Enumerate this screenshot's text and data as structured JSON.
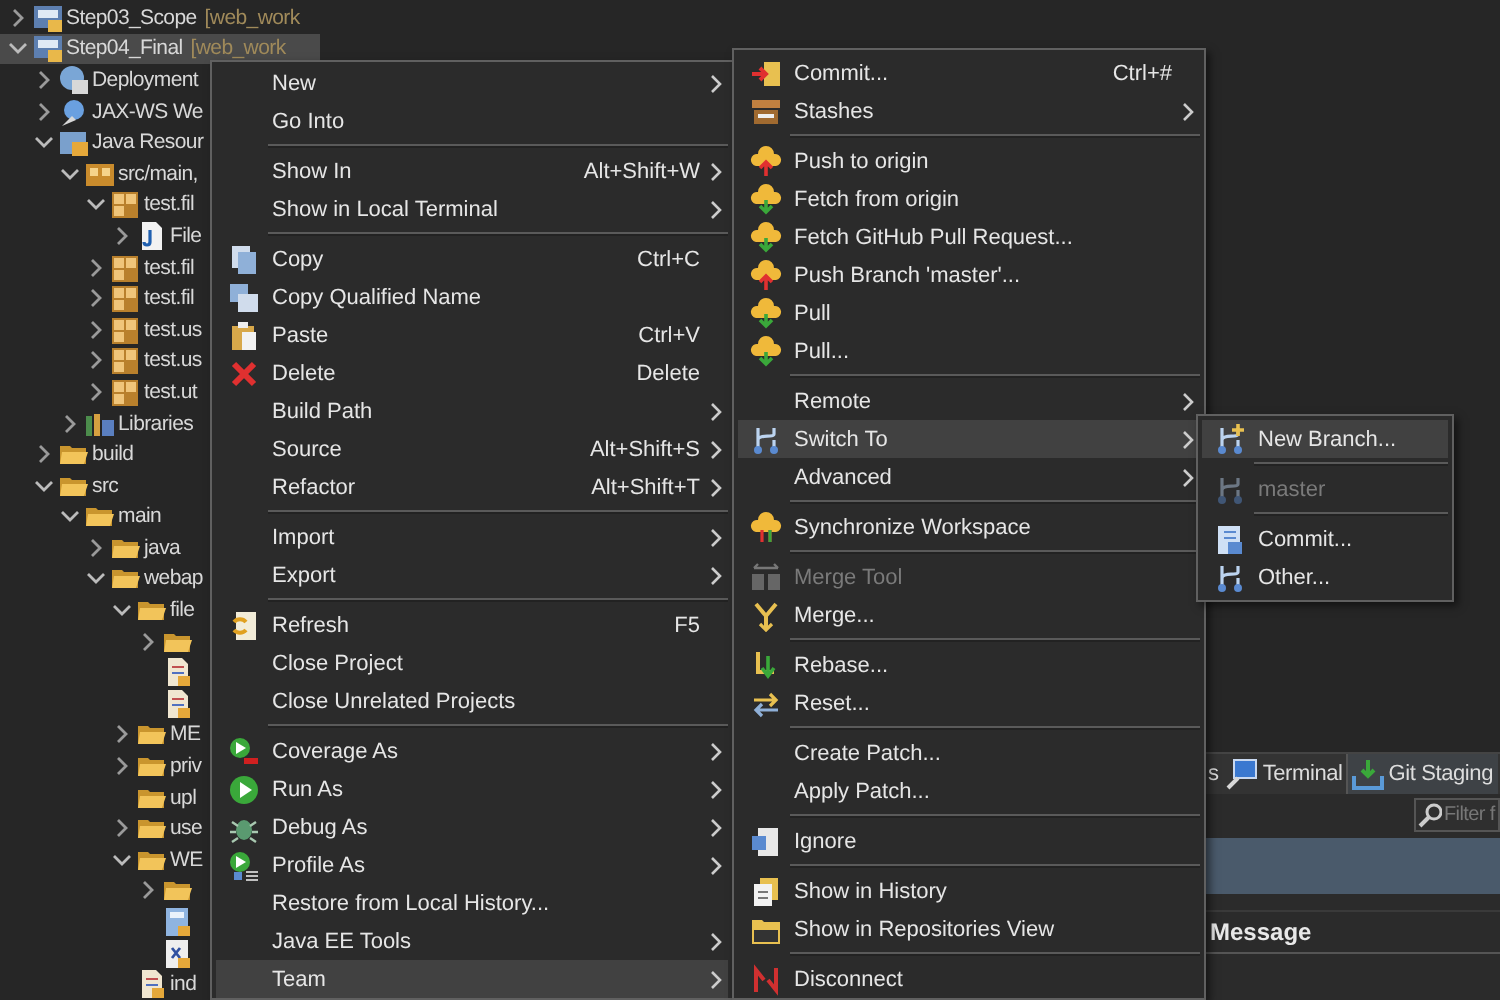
{
  "tree": {
    "rows": [
      {
        "kind": "project",
        "label": "Step03_Scope",
        "decoration": "[web_work",
        "expanded": false,
        "selected": false
      },
      {
        "kind": "project",
        "label": "Step04_Final",
        "decoration": "[web_work",
        "expanded": true,
        "selected": true,
        "children": [
          {
            "kind": "deploy",
            "label": "Deployment",
            "expanded": false,
            "selected": false
          },
          {
            "kind": "webservice",
            "label": "JAX-WS We",
            "expanded": false,
            "selected": false
          },
          {
            "kind": "javares",
            "label": "Java Resour",
            "expanded": true,
            "selected": false,
            "children": [
              {
                "kind": "srcfolder",
                "label": "src/main,",
                "expanded": true,
                "selected": false,
                "children": [
                  {
                    "kind": "package",
                    "label": "test.fil",
                    "expanded": true,
                    "selected": false,
                    "children": [
                      {
                        "kind": "javafile",
                        "label": "File",
                        "expanded": false,
                        "selected": false
                      }
                    ]
                  },
                  {
                    "kind": "package",
                    "label": "test.fil",
                    "expanded": false,
                    "selected": false
                  },
                  {
                    "kind": "package",
                    "label": "test.fil",
                    "expanded": false,
                    "selected": false
                  },
                  {
                    "kind": "package",
                    "label": "test.us",
                    "expanded": false,
                    "selected": false
                  },
                  {
                    "kind": "package",
                    "label": "test.us",
                    "expanded": false,
                    "selected": false
                  },
                  {
                    "kind": "package",
                    "label": "test.ut",
                    "expanded": false,
                    "selected": false
                  }
                ]
              },
              {
                "kind": "library",
                "label": "Libraries",
                "expanded": false,
                "selected": false
              }
            ]
          },
          {
            "kind": "folder",
            "label": "build",
            "expanded": false,
            "selected": false
          },
          {
            "kind": "folder",
            "label": "src",
            "expanded": true,
            "selected": false,
            "children": [
              {
                "kind": "folder",
                "label": "main",
                "expanded": true,
                "selected": false,
                "children": [
                  {
                    "kind": "folder",
                    "label": "java",
                    "expanded": false,
                    "selected": false
                  },
                  {
                    "kind": "folder",
                    "label": "webap",
                    "expanded": true,
                    "selected": false,
                    "children": [
                      {
                        "kind": "folder",
                        "label": "file",
                        "expanded": true,
                        "selected": false,
                        "children": [
                          {
                            "kind": "folder",
                            "expanded": false,
                            "selected": false
                          },
                          {
                            "kind": "file",
                            "selected": false
                          },
                          {
                            "kind": "file",
                            "selected": false
                          }
                        ]
                      },
                      {
                        "kind": "folder",
                        "label": "ME",
                        "expanded": false,
                        "selected": false
                      },
                      {
                        "kind": "folder",
                        "label": "priv",
                        "expanded": false,
                        "selected": false
                      },
                      {
                        "kind": "folder",
                        "label": "upl",
                        "selected": false
                      },
                      {
                        "kind": "folder",
                        "label": "use",
                        "expanded": false,
                        "selected": false
                      },
                      {
                        "kind": "folder",
                        "label": "WE",
                        "expanded": true,
                        "selected": false,
                        "children": [
                          {
                            "kind": "folder",
                            "expanded": false,
                            "selected": false
                          },
                          {
                            "kind": "page",
                            "selected": false
                          },
                          {
                            "kind": "xml",
                            "selected": false
                          }
                        ]
                      },
                      {
                        "kind": "file",
                        "label": "ind",
                        "selected": false
                      }
                    ]
                  }
                ]
              }
            ]
          }
        ]
      }
    ]
  },
  "menus": [
    {
      "items": [
        {
          "kind": "item",
          "label": "New",
          "submenu": true,
          "selected": false,
          "disabled": false
        },
        {
          "kind": "item",
          "label": "Go Into",
          "submenu": false,
          "selected": false,
          "disabled": false
        },
        {
          "kind": "separator"
        },
        {
          "kind": "item",
          "label": "Show In",
          "shortcut": "Alt+Shift+W",
          "submenu": true,
          "selected": false,
          "disabled": false
        },
        {
          "kind": "item",
          "label": "Show in Local Terminal",
          "submenu": true,
          "selected": false,
          "disabled": false
        },
        {
          "kind": "separator"
        },
        {
          "kind": "item",
          "label": "Copy",
          "shortcut": "Ctrl+C",
          "submenu": false,
          "selected": false,
          "disabled": false
        },
        {
          "kind": "item",
          "label": "Copy Qualified Name",
          "submenu": false,
          "selected": false,
          "disabled": false
        },
        {
          "kind": "item",
          "label": "Paste",
          "shortcut": "Ctrl+V",
          "submenu": false,
          "selected": false,
          "disabled": false
        },
        {
          "kind": "item",
          "label": "Delete",
          "shortcut": "Delete",
          "submenu": false,
          "selected": false,
          "disabled": false
        },
        {
          "kind": "item",
          "label": "Build Path",
          "submenu": true,
          "selected": false,
          "disabled": false
        },
        {
          "kind": "item",
          "label": "Source",
          "shortcut": "Alt+Shift+S",
          "submenu": true,
          "selected": false,
          "disabled": false
        },
        {
          "kind": "item",
          "label": "Refactor",
          "shortcut": "Alt+Shift+T",
          "submenu": true,
          "selected": false,
          "disabled": false
        },
        {
          "kind": "separator"
        },
        {
          "kind": "item",
          "label": "Import",
          "submenu": true,
          "selected": false,
          "disabled": false
        },
        {
          "kind": "item",
          "label": "Export",
          "submenu": true,
          "selected": false,
          "disabled": false
        },
        {
          "kind": "separator"
        },
        {
          "kind": "item",
          "label": "Refresh",
          "shortcut": "F5",
          "submenu": false,
          "selected": false,
          "disabled": false
        },
        {
          "kind": "item",
          "label": "Close Project",
          "submenu": false,
          "selected": false,
          "disabled": false
        },
        {
          "kind": "item",
          "label": "Close Unrelated Projects",
          "submenu": false,
          "selected": false,
          "disabled": false
        },
        {
          "kind": "separator"
        },
        {
          "kind": "item",
          "label": "Coverage As",
          "submenu": true,
          "selected": false,
          "disabled": false
        },
        {
          "kind": "item",
          "label": "Run As",
          "submenu": true,
          "selected": false,
          "disabled": false
        },
        {
          "kind": "item",
          "label": "Debug As",
          "submenu": true,
          "selected": false,
          "disabled": false
        },
        {
          "kind": "item",
          "label": "Profile As",
          "submenu": true,
          "selected": false,
          "disabled": false
        },
        {
          "kind": "item",
          "label": "Restore from Local History...",
          "submenu": false,
          "selected": false,
          "disabled": false
        },
        {
          "kind": "item",
          "label": "Java EE Tools",
          "submenu": true,
          "selected": false,
          "disabled": false
        },
        {
          "kind": "item",
          "label": "Team",
          "submenu": true,
          "selected": true,
          "disabled": false
        }
      ]
    },
    {
      "items": [
        {
          "kind": "item",
          "label": "Commit...",
          "shortcut": "Ctrl+#",
          "submenu": false,
          "selected": false,
          "disabled": false
        },
        {
          "kind": "item",
          "label": "Stashes",
          "submenu": true,
          "selected": false,
          "disabled": false
        },
        {
          "kind": "separator"
        },
        {
          "kind": "item",
          "label": "Push to origin",
          "submenu": false,
          "selected": false,
          "disabled": false
        },
        {
          "kind": "item",
          "label": "Fetch from origin",
          "submenu": false,
          "selected": false,
          "disabled": false
        },
        {
          "kind": "item",
          "label": "Fetch GitHub Pull Request...",
          "submenu": false,
          "selected": false,
          "disabled": false
        },
        {
          "kind": "item",
          "label": "Push Branch 'master'...",
          "submenu": false,
          "selected": false,
          "disabled": false
        },
        {
          "kind": "item",
          "label": "Pull",
          "submenu": false,
          "selected": false,
          "disabled": false
        },
        {
          "kind": "item",
          "label": "Pull...",
          "submenu": false,
          "selected": false,
          "disabled": false
        },
        {
          "kind": "separator"
        },
        {
          "kind": "item",
          "label": "Remote",
          "submenu": true,
          "selected": false,
          "disabled": false
        },
        {
          "kind": "item",
          "label": "Switch To",
          "submenu": true,
          "selected": true,
          "disabled": false
        },
        {
          "kind": "item",
          "label": "Advanced",
          "submenu": true,
          "selected": false,
          "disabled": false
        },
        {
          "kind": "separator"
        },
        {
          "kind": "item",
          "label": "Synchronize Workspace",
          "submenu": false,
          "selected": false,
          "disabled": false
        },
        {
          "kind": "separator"
        },
        {
          "kind": "item",
          "label": "Merge Tool",
          "submenu": false,
          "selected": false,
          "disabled": true
        },
        {
          "kind": "item",
          "label": "Merge...",
          "submenu": false,
          "selected": false,
          "disabled": false
        },
        {
          "kind": "separator"
        },
        {
          "kind": "item",
          "label": "Rebase...",
          "submenu": false,
          "selected": false,
          "disabled": false
        },
        {
          "kind": "item",
          "label": "Reset...",
          "submenu": false,
          "selected": false,
          "disabled": false
        },
        {
          "kind": "separator"
        },
        {
          "kind": "item",
          "label": "Create Patch...",
          "submenu": false,
          "selected": false,
          "disabled": false
        },
        {
          "kind": "item",
          "label": "Apply Patch...",
          "submenu": false,
          "selected": false,
          "disabled": false
        },
        {
          "kind": "separator"
        },
        {
          "kind": "item",
          "label": "Ignore",
          "submenu": false,
          "selected": false,
          "disabled": false
        },
        {
          "kind": "separator"
        },
        {
          "kind": "item",
          "label": "Show in History",
          "submenu": false,
          "selected": false,
          "disabled": false
        },
        {
          "kind": "item",
          "label": "Show in Repositories View",
          "submenu": false,
          "selected": false,
          "disabled": false
        },
        {
          "kind": "separator"
        },
        {
          "kind": "item",
          "label": "Disconnect",
          "submenu": false,
          "selected": false,
          "disabled": false
        }
      ]
    },
    {
      "items": [
        {
          "kind": "item",
          "label": "New Branch...",
          "submenu": false,
          "selected": true,
          "disabled": false
        },
        {
          "kind": "separator"
        },
        {
          "kind": "item",
          "label": "master",
          "submenu": false,
          "selected": false,
          "disabled": true
        },
        {
          "kind": "separator"
        },
        {
          "kind": "item",
          "label": "Commit...",
          "submenu": false,
          "selected": false,
          "disabled": false
        },
        {
          "kind": "item",
          "label": "Other...",
          "submenu": false,
          "selected": false,
          "disabled": false
        }
      ]
    }
  ],
  "bottom_panel": {
    "tabs": [
      {
        "label": "s",
        "selected": false
      },
      {
        "label": "Terminal",
        "selected": false
      },
      {
        "label": "Git Staging",
        "selected": true
      }
    ],
    "filter": {
      "placeholder": "Filter f"
    },
    "columns": [
      "Message"
    ]
  }
}
